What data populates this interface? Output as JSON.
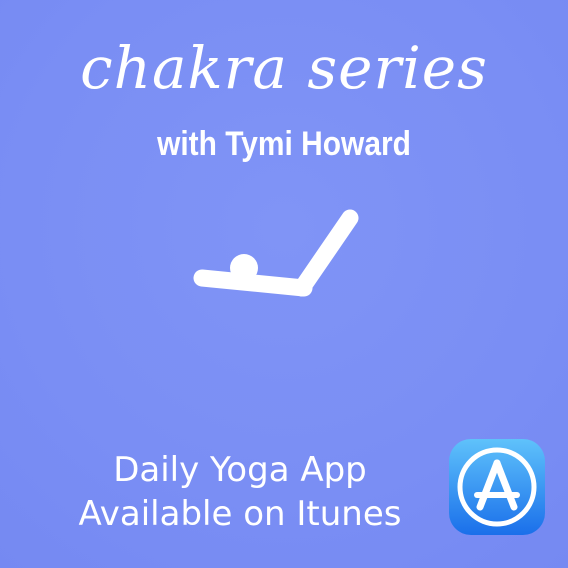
{
  "header": {
    "title": "chakra series",
    "subtitle": "with Tymi Howard"
  },
  "logo": {
    "icon": "yoga-pose-icon"
  },
  "caption": {
    "line1": "Daily Yoga App",
    "line2": "Available on Itunes"
  },
  "store_badge": {
    "icon": "app-store-icon"
  },
  "colors": {
    "background": "#7b8ff5",
    "text": "#ffffff",
    "app_store_blue": "#1e8ef5"
  }
}
